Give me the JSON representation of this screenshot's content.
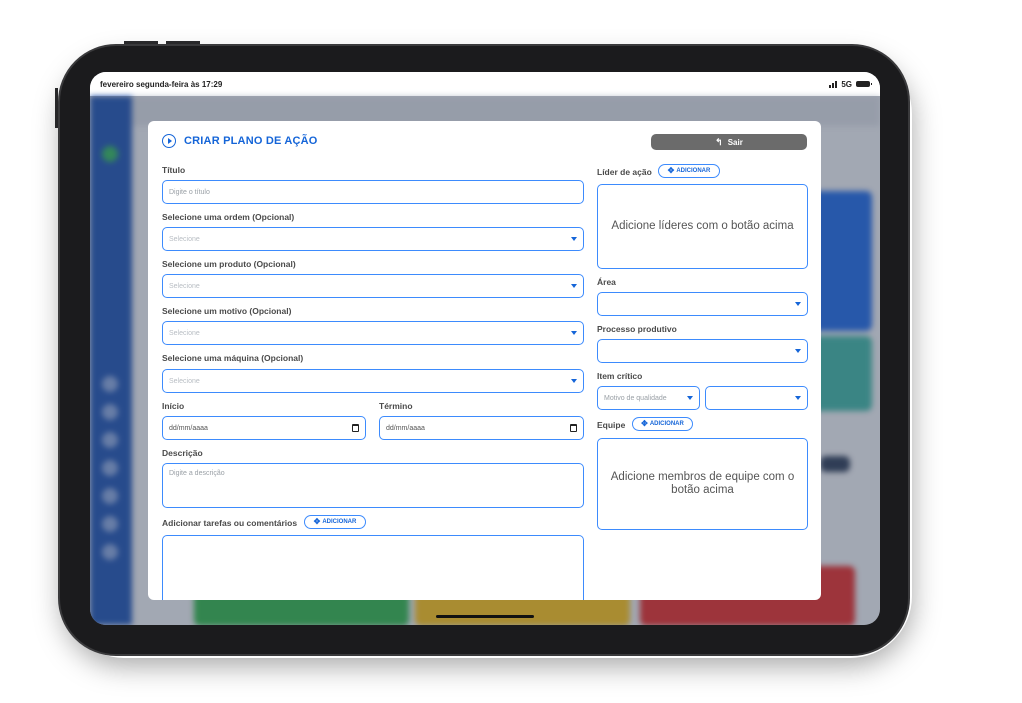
{
  "status_bar": {
    "datetime": "fevereiro segunda-feira às 17:29",
    "network": "5G"
  },
  "modal": {
    "title": "CRIAR PLANO DE AÇÃO",
    "exit_label": "Sair",
    "fields": {
      "titulo": {
        "label": "Título",
        "placeholder": "Digite o título"
      },
      "ordem": {
        "label": "Selecione uma ordem (Opcional)",
        "placeholder": "Selecione"
      },
      "produto": {
        "label": "Selecione um produto (Opcional)",
        "placeholder": "Selecione"
      },
      "motivo": {
        "label": "Selecione um motivo (Opcional)",
        "placeholder": "Selecione"
      },
      "maquina": {
        "label": "Selecione uma máquina (Opcional)",
        "placeholder": "Selecione"
      },
      "inicio": {
        "label": "Início",
        "value": "dd/mm/aaaa"
      },
      "termino": {
        "label": "Término",
        "value": "dd/mm/aaaa"
      },
      "descricao": {
        "label": "Descrição",
        "placeholder": "Digite a descrição"
      },
      "tarefas": {
        "label": "Adicionar tarefas ou comentários",
        "button": "ADICIONAR"
      }
    },
    "right": {
      "lider": {
        "label": "Líder de ação",
        "button": "ADICIONAR",
        "empty": "Adicione líderes com o botão acima"
      },
      "area": {
        "label": "Área",
        "value": ""
      },
      "processo": {
        "label": "Processo produtivo",
        "value": ""
      },
      "item_critico": {
        "label": "Item crítico",
        "select1": "Motivo de qualidade",
        "select2": ""
      },
      "equipe": {
        "label": "Equipe",
        "button": "ADICIONAR",
        "empty": "Adicione membros de equipe com o botão acima"
      }
    }
  },
  "colors": {
    "accent": "#1565d8",
    "field_border": "#3d8bfd",
    "exit_button": "#6b6b6b",
    "sidebar": "#1d4fa8"
  }
}
